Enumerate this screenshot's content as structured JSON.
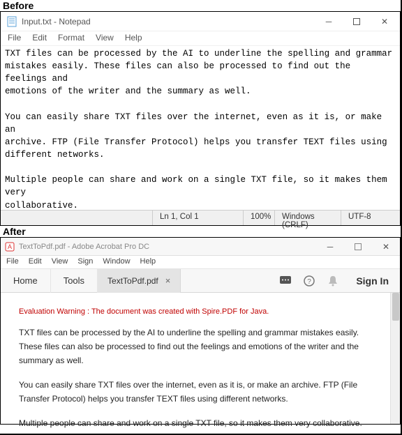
{
  "labels": {
    "before": "Before",
    "after": "After"
  },
  "notepad": {
    "title": "Input.txt - Notepad",
    "menu": [
      "File",
      "Edit",
      "Format",
      "View",
      "Help"
    ],
    "body": "TXT files can be processed by the AI to underline the spelling and grammar\nmistakes easily. These files can also be processed to find out the feelings and\nemotions of the writer and the summary as well.\n\nYou can easily share TXT files over the internet, even as it is, or make an\narchive. FTP (File Transfer Protocol) helps you transfer TEXT files using\ndifferent networks.\n\nMultiple people can share and work on a single TXT file, so it makes them very\ncollaborative.",
    "status": {
      "pos": "Ln 1, Col 1",
      "zoom": "100%",
      "eol": "Windows (CRLF)",
      "enc": "UTF-8"
    }
  },
  "acrobat": {
    "title": "TextToPdf.pdf - Adobe Acrobat Pro DC",
    "menu": [
      "File",
      "Edit",
      "View",
      "Sign",
      "Window",
      "Help"
    ],
    "toolbar": {
      "home": "Home",
      "tools": "Tools",
      "tab": "TextToPdf.pdf",
      "close": "×",
      "signin": "Sign In"
    },
    "warning": "Evaluation Warning : The document was created with Spire.PDF for Java.",
    "paragraphs": [
      "TXT files can be processed by the AI to underline the spelling and grammar mistakes easily. These files can also be processed to find out the feelings and emotions of the writer and the summary as well.",
      "You can easily share TXT files over the internet, even as it is, or make an archive. FTP (File Transfer Protocol) helps you transfer TEXT files using different networks.",
      "Multiple people can share and work on a single TXT file, so it makes them very collaborative."
    ]
  }
}
